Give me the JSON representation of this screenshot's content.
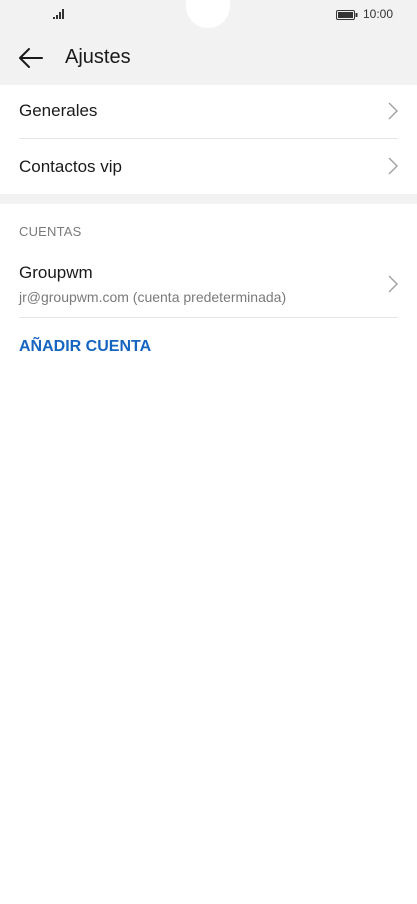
{
  "status_bar": {
    "time": "10:00",
    "signal_icon": "signal-bars-icon",
    "battery_icon": "battery-icon"
  },
  "header": {
    "title": "Ajustes",
    "back_icon": "arrow-left-icon"
  },
  "settings": [
    {
      "label": "Generales"
    },
    {
      "label": "Contactos vip"
    }
  ],
  "accounts": {
    "header": "CUENTAS",
    "items": [
      {
        "name": "Groupwm",
        "detail": "jr@groupwm.com (cuenta predeterminada)"
      }
    ],
    "add_label": "AÑADIR CUENTA"
  },
  "colors": {
    "accent": "#1565c0",
    "header_bg": "#f2f2f2",
    "text": "#1a1a1a",
    "secondary_text": "#7a7a7a"
  }
}
